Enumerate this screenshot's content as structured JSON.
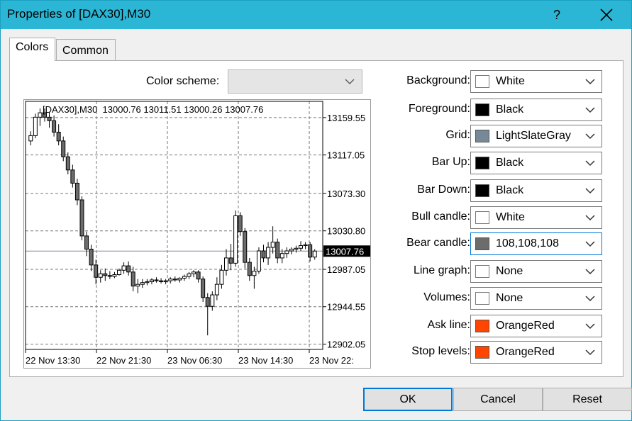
{
  "window": {
    "title": "Properties of [DAX30],M30",
    "help_label": "?"
  },
  "tabs": [
    {
      "label": "Colors",
      "active": true
    },
    {
      "label": "Common",
      "active": false
    }
  ],
  "color_scheme": {
    "label": "Color scheme:",
    "value": ""
  },
  "chart_data": {
    "type": "candlestick",
    "info_line": "[DAX30],M30  13000.76 13011.51 13000.26 13007.76",
    "price_ticks": [
      "13159.55",
      "13117.05",
      "13073.30",
      "13030.80",
      "12987.05",
      "12944.55",
      "12902.05"
    ],
    "price_tick_values": [
      13159.55,
      13117.05,
      13073.3,
      13030.8,
      12987.05,
      12944.55,
      12902.05
    ],
    "current_price_label": "13007.76",
    "current_price": 13007.76,
    "time_labels": [
      "22 Nov 13:30",
      "22 Nov 21:30",
      "23 Nov 06:30",
      "23 Nov 14:30",
      "23 Nov 22:"
    ],
    "ylim": [
      12896,
      13178
    ],
    "grid": true,
    "candles": [
      [
        13133,
        13144,
        13128,
        13139
      ],
      [
        13139,
        13164,
        13136,
        13160
      ],
      [
        13160,
        13170,
        13150,
        13165
      ],
      [
        13165,
        13170,
        13155,
        13160
      ],
      [
        13160,
        13166,
        13148,
        13156
      ],
      [
        13156,
        13162,
        13138,
        13143
      ],
      [
        13143,
        13152,
        13128,
        13133
      ],
      [
        13133,
        13138,
        13110,
        13115
      ],
      [
        13115,
        13120,
        13095,
        13100
      ],
      [
        13100,
        13106,
        13080,
        13085
      ],
      [
        13085,
        13090,
        13060,
        13066
      ],
      [
        13066,
        13070,
        13020,
        13025
      ],
      [
        13025,
        13030,
        13002,
        13010
      ],
      [
        13010,
        13015,
        12985,
        12992
      ],
      [
        12992,
        12998,
        12970,
        12978
      ],
      [
        12978,
        12986,
        12972,
        12982
      ],
      [
        12982,
        12988,
        12974,
        12980
      ],
      [
        12980,
        12985,
        12976,
        12979
      ],
      [
        12979,
        12984,
        12977,
        12981
      ],
      [
        12981,
        12988,
        12980,
        12986
      ],
      [
        12986,
        12995,
        12982,
        12991
      ],
      [
        12991,
        12996,
        12980,
        12984
      ],
      [
        12984,
        12990,
        12962,
        12968
      ],
      [
        12968,
        12976,
        12960,
        12970
      ],
      [
        12970,
        12976,
        12966,
        12972
      ],
      [
        12972,
        12976,
        12969,
        12973
      ],
      [
        12973,
        12977,
        12970,
        12975
      ],
      [
        12975,
        12978,
        12972,
        12974
      ],
      [
        12974,
        12977,
        12971,
        12973
      ],
      [
        12973,
        12976,
        12970,
        12974
      ],
      [
        12974,
        12978,
        12971,
        12976
      ],
      [
        12976,
        12979,
        12973,
        12975
      ],
      [
        12975,
        12978,
        12972,
        12977
      ],
      [
        12977,
        12981,
        12974,
        12979
      ],
      [
        12979,
        12984,
        12976,
        12982
      ],
      [
        12982,
        12986,
        12978,
        12984
      ],
      [
        12984,
        12986,
        12972,
        12976
      ],
      [
        12976,
        12979,
        12950,
        12955
      ],
      [
        12955,
        12960,
        12912,
        12945
      ],
      [
        12945,
        12962,
        12940,
        12958
      ],
      [
        12958,
        12978,
        12952,
        12970
      ],
      [
        12970,
        12992,
        12965,
        12986
      ],
      [
        12986,
        13010,
        12980,
        13000
      ],
      [
        13000,
        13016,
        12986,
        12994
      ],
      [
        12994,
        13054,
        12990,
        13048
      ],
      [
        13048,
        13052,
        13025,
        13030
      ],
      [
        13030,
        13034,
        12988,
        12995
      ],
      [
        12995,
        13000,
        12974,
        12980
      ],
      [
        12980,
        12990,
        12965,
        12985
      ],
      [
        12985,
        13012,
        12982,
        13008
      ],
      [
        13008,
        13015,
        12995,
        13000
      ],
      [
        13000,
        13018,
        12992,
        13012
      ],
      [
        13012,
        13036,
        13005,
        13018
      ],
      [
        13018,
        13022,
        12994,
        13000
      ],
      [
        13000,
        13010,
        12994,
        13005
      ],
      [
        13005,
        13012,
        13000,
        13008
      ],
      [
        13008,
        13012,
        13004,
        13010
      ],
      [
        13010,
        13014,
        13006,
        13011
      ],
      [
        13011,
        13019,
        13008,
        13014
      ],
      [
        13014,
        13018,
        13010,
        13015
      ],
      [
        13015,
        13018,
        12996,
        13001
      ],
      [
        13001,
        13010,
        12998,
        13007.76
      ]
    ]
  },
  "properties": [
    {
      "label": "Background:",
      "value": "White",
      "color": "#ffffff"
    },
    {
      "label": "Foreground:",
      "value": "Black",
      "color": "#000000"
    },
    {
      "label": "Grid:",
      "value": "LightSlateGray",
      "color": "#778899"
    },
    {
      "label": "Bar Up:",
      "value": "Black",
      "color": "#000000"
    },
    {
      "label": "Bar Down:",
      "value": "Black",
      "color": "#000000"
    },
    {
      "label": "Bull candle:",
      "value": "White",
      "color": "#ffffff"
    },
    {
      "label": "Bear candle:",
      "value": "108,108,108",
      "color": "#6c6c6c"
    },
    {
      "label": "Line graph:",
      "value": "None",
      "color": "#ffffff"
    },
    {
      "label": "Volumes:",
      "value": "None",
      "color": "#ffffff"
    },
    {
      "label": "Ask line:",
      "value": "OrangeRed",
      "color": "#ff4500"
    },
    {
      "label": "Stop levels:",
      "value": "OrangeRed",
      "color": "#ff4500"
    }
  ],
  "buttons": {
    "ok": "OK",
    "cancel": "Cancel",
    "reset": "Reset"
  }
}
